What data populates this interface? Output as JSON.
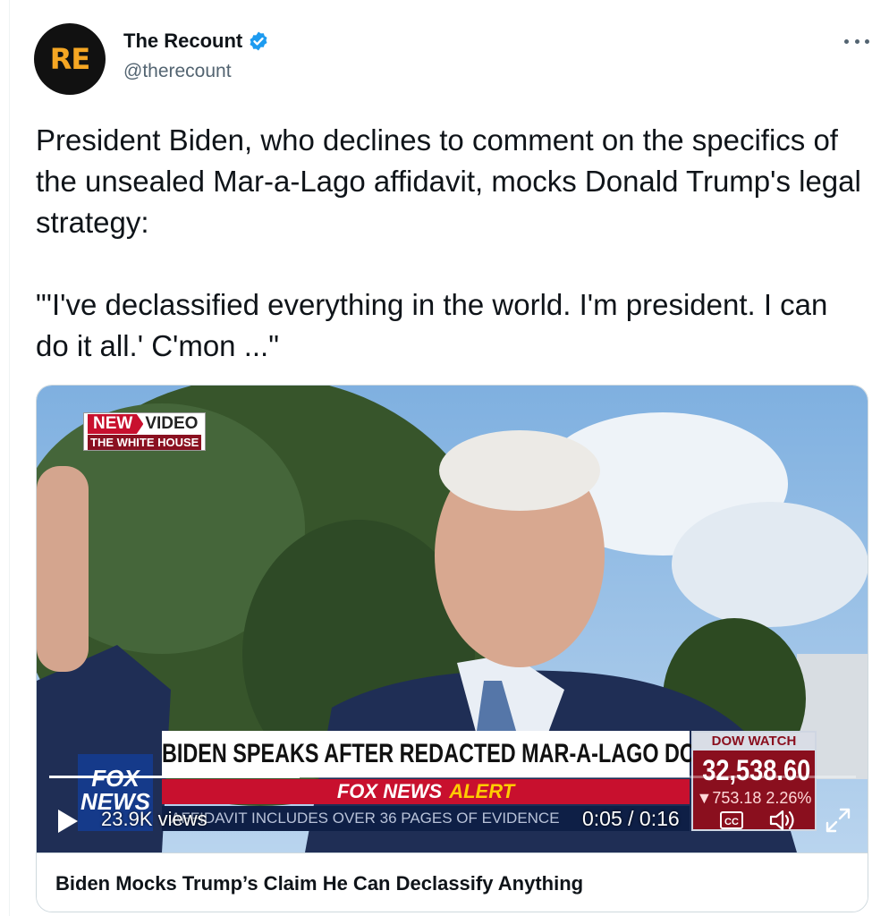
{
  "account": {
    "avatar_text": "RE",
    "display_name": "The Recount",
    "handle": "@therecount",
    "verified": true,
    "verified_color": "#1d9bf0"
  },
  "tweet": {
    "text": "President Biden, who declines to comment on the specifics of the unsealed Mar-a-Lago affidavit, mocks Donald Trump's legal strategy:\n\n\"'I've declassified everything in the world. I'm president. I can do it all.' C'mon ...\""
  },
  "video": {
    "overlay": {
      "new_label": "NEW",
      "video_label": "VIDEO",
      "source_label": "THE WHITE HOUSE",
      "headline": "BIDEN SPEAKS AFTER REDACTED MAR-A-LAGO DOC RELEASE",
      "alert_part1": "FOX NEWS",
      "alert_part2": "ALERT",
      "ticker": "AFFIDAVIT INCLUDES OVER 36 PAGES OF EVIDENCE",
      "network_logo": "FOX NEWS",
      "dow_title": "DOW WATCH",
      "dow_value": "32,538.60",
      "dow_change": "▼753.18 2.26%"
    },
    "views": "23.9K views",
    "time": "0:05 / 0:16",
    "progress_fraction": 0.31,
    "cc_label": "CC"
  },
  "card": {
    "title": "Biden Mocks Trump’s Claim He Can Declassify Anything"
  },
  "colors": {
    "text": "#0f1419",
    "secondary": "#536471",
    "border": "#cfd9de",
    "fox_red": "#c8102e",
    "fox_blue": "#153a8a"
  },
  "icons": [
    "more-icon",
    "verified-badge-icon",
    "play-icon",
    "closed-captions-icon",
    "volume-icon",
    "fullscreen-icon"
  ]
}
